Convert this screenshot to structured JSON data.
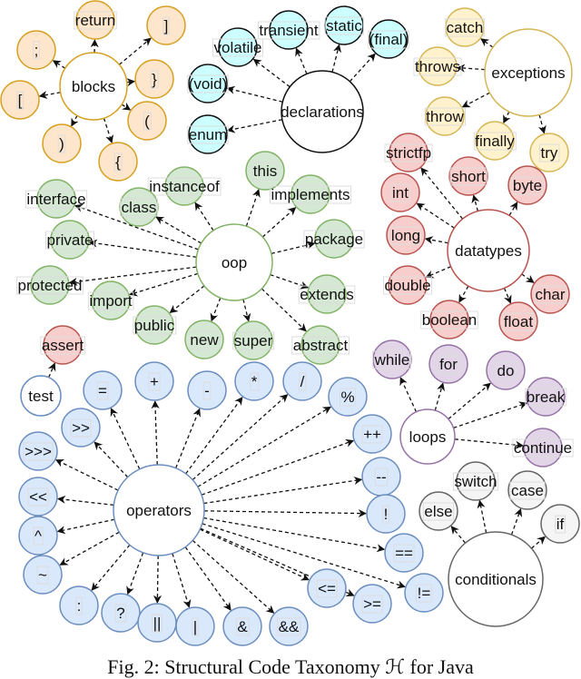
{
  "caption": "Fig. 2: Structural Code Taxonomy ℋ for Java",
  "groups": [
    {
      "name": "blocks",
      "fill": "#fde6cc",
      "stroke": "#d6a020",
      "children": [
        "return",
        "]",
        ";",
        "}",
        "[",
        "(",
        ")",
        "{"
      ]
    },
    {
      "name": "declarations",
      "fill": "#ccffff",
      "stroke": "#111111",
      "children": [
        "transient",
        "static",
        "volatile",
        "(final)",
        "(void)",
        "enum"
      ]
    },
    {
      "name": "exceptions",
      "fill": "#fff2cc",
      "stroke": "#d6b656",
      "children": [
        "catch",
        "throws",
        "throw",
        "finally",
        "try"
      ]
    },
    {
      "name": "oop",
      "fill": "#d5e8d4",
      "stroke": "#82b366",
      "children": [
        "this",
        "instanceof",
        "implements",
        "class",
        "interface",
        "private",
        "package",
        "protected",
        "import",
        "extends",
        "public",
        "new",
        "super",
        "abstract"
      ]
    },
    {
      "name": "datatypes",
      "fill": "#f8cecc",
      "stroke": "#b85450",
      "children": [
        "strictfp",
        "short",
        "byte",
        "int",
        "long",
        "double",
        "char",
        "boolean",
        "float"
      ]
    },
    {
      "name": "test",
      "fill": "#f8cecc",
      "stroke": "#b85450",
      "centerStroke": "#6c8ebf",
      "children": [
        "assert"
      ]
    },
    {
      "name": "operators",
      "fill": "#dae8fc",
      "stroke": "#6c8ebf",
      "children": [
        "=",
        "+",
        "-",
        "*",
        "/",
        "%",
        ">>",
        "++",
        ">>>",
        "--",
        "<<",
        "!",
        "^",
        "==",
        "~",
        "!=",
        ":",
        ">=",
        "?",
        "<=",
        "||",
        "|",
        "&",
        "&&"
      ]
    },
    {
      "name": "loops",
      "fill": "#e1d5e7",
      "stroke": "#9673a6",
      "children": [
        "while",
        "for",
        "do",
        "break",
        "continue"
      ]
    },
    {
      "name": "conditionals",
      "fill": "#f5f5f5",
      "stroke": "#666666",
      "children": [
        "else",
        "switch",
        "case",
        "if"
      ]
    }
  ]
}
